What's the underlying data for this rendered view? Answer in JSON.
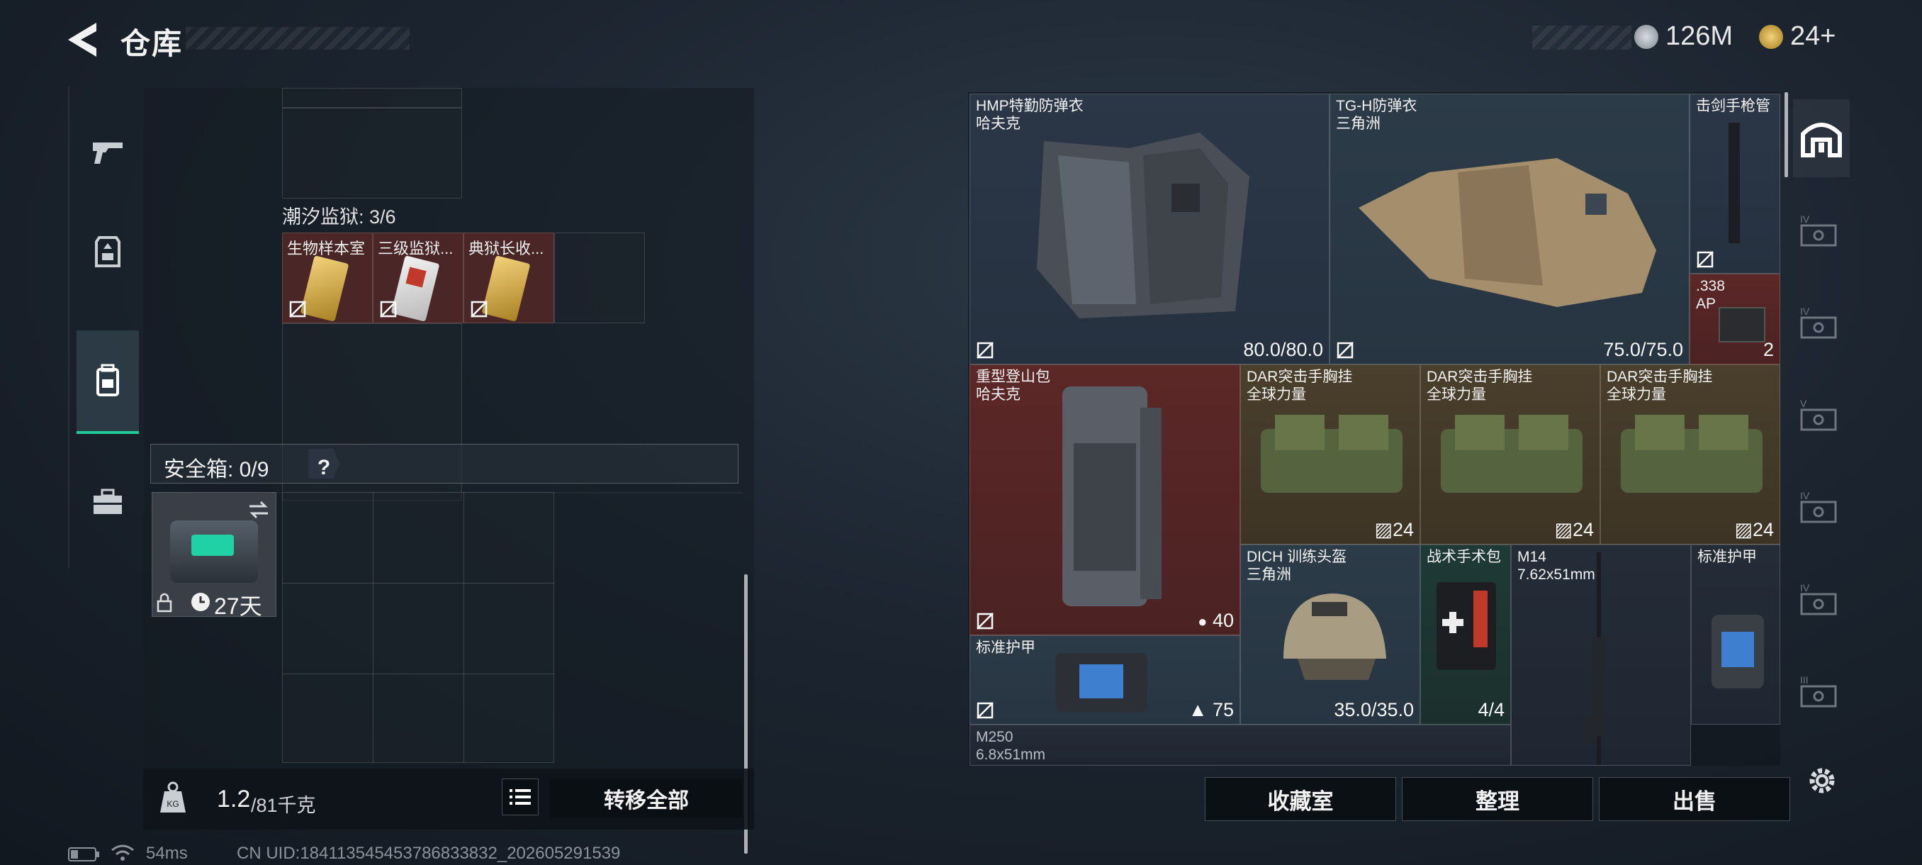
{
  "header": {
    "title": "仓库",
    "currency_primary": "126M",
    "currency_secondary": "24+"
  },
  "left_rail": {
    "items": [
      {
        "icon": "gun-icon"
      },
      {
        "icon": "armor-icon"
      },
      {
        "icon": "backpack-icon",
        "active": true
      },
      {
        "icon": "toolbox-icon"
      }
    ]
  },
  "stash": {
    "section_tidal_prison": "潮汐监狱: 3/6",
    "keycards": [
      {
        "label": "生物样本室",
        "color": "#c9a23a"
      },
      {
        "label": "三级监狱...",
        "color": "#b83b3b"
      },
      {
        "label": "典狱长收...",
        "color": "#c9a23a"
      }
    ],
    "safe_box_label": "安全箱: 0/9",
    "safe_box_help": "?",
    "safe_box_timer": "27天",
    "weight_current": "1.2",
    "weight_max": "/81千克",
    "transfer_all": "转移全部"
  },
  "inventory": {
    "items": [
      {
        "id": "hmp-vest",
        "name": "HMP特勤防弹衣",
        "sub": "哈夫克",
        "value": "80.0/80.0"
      },
      {
        "id": "tgh-vest",
        "name": "TG-H防弹衣",
        "sub": "三角洲",
        "value": "75.0/75.0"
      },
      {
        "id": "barrel",
        "name": "击剑手枪管",
        "sub": "",
        "value": ""
      },
      {
        "id": "ammo-338",
        "name": ".338",
        "sub": "AP",
        "value": "2"
      },
      {
        "id": "mountain-pack",
        "name": "重型登山包",
        "sub": "哈夫克",
        "value": "40"
      },
      {
        "id": "dar-1",
        "name": "DAR突击手胸挂",
        "sub": "全球力量",
        "value": "24"
      },
      {
        "id": "dar-2",
        "name": "DAR突击手胸挂",
        "sub": "全球力量",
        "value": "24"
      },
      {
        "id": "dar-3",
        "name": "DAR突击手胸挂",
        "sub": "全球力量",
        "value": "24"
      },
      {
        "id": "helmet",
        "name": "DICH 训练头盔",
        "sub": "三角洲",
        "value": "35.0/35.0"
      },
      {
        "id": "medkit",
        "name": "战术手术包",
        "sub": "",
        "value": "4/4"
      },
      {
        "id": "m14",
        "name": "M14",
        "sub": "7.62x51mm",
        "value": ""
      },
      {
        "id": "plate-1",
        "name": "标准护甲",
        "sub": "",
        "value": ""
      },
      {
        "id": "plate-2",
        "name": "标准护甲",
        "sub": "",
        "value": "75"
      },
      {
        "id": "m250",
        "name": "M250",
        "sub": "6.8x51mm",
        "value": ""
      }
    ],
    "buttons": {
      "collection": "收藏室",
      "organize": "整理",
      "sell": "出售"
    }
  },
  "right_rail": {
    "items": [
      {
        "icon": "home-icon",
        "active": true
      },
      {
        "icon": "container-iv-icon",
        "tier": "IV"
      },
      {
        "icon": "container-iv-icon",
        "tier": "IV"
      },
      {
        "icon": "container-v-icon",
        "tier": "V"
      },
      {
        "icon": "container-iv-icon",
        "tier": "IV"
      },
      {
        "icon": "container-iv-icon",
        "tier": "IV"
      },
      {
        "icon": "container-iii-icon",
        "tier": "III"
      }
    ]
  },
  "status": {
    "ping": "54ms",
    "uid": "CN UID:18411354545378683383​2_202605291539"
  }
}
